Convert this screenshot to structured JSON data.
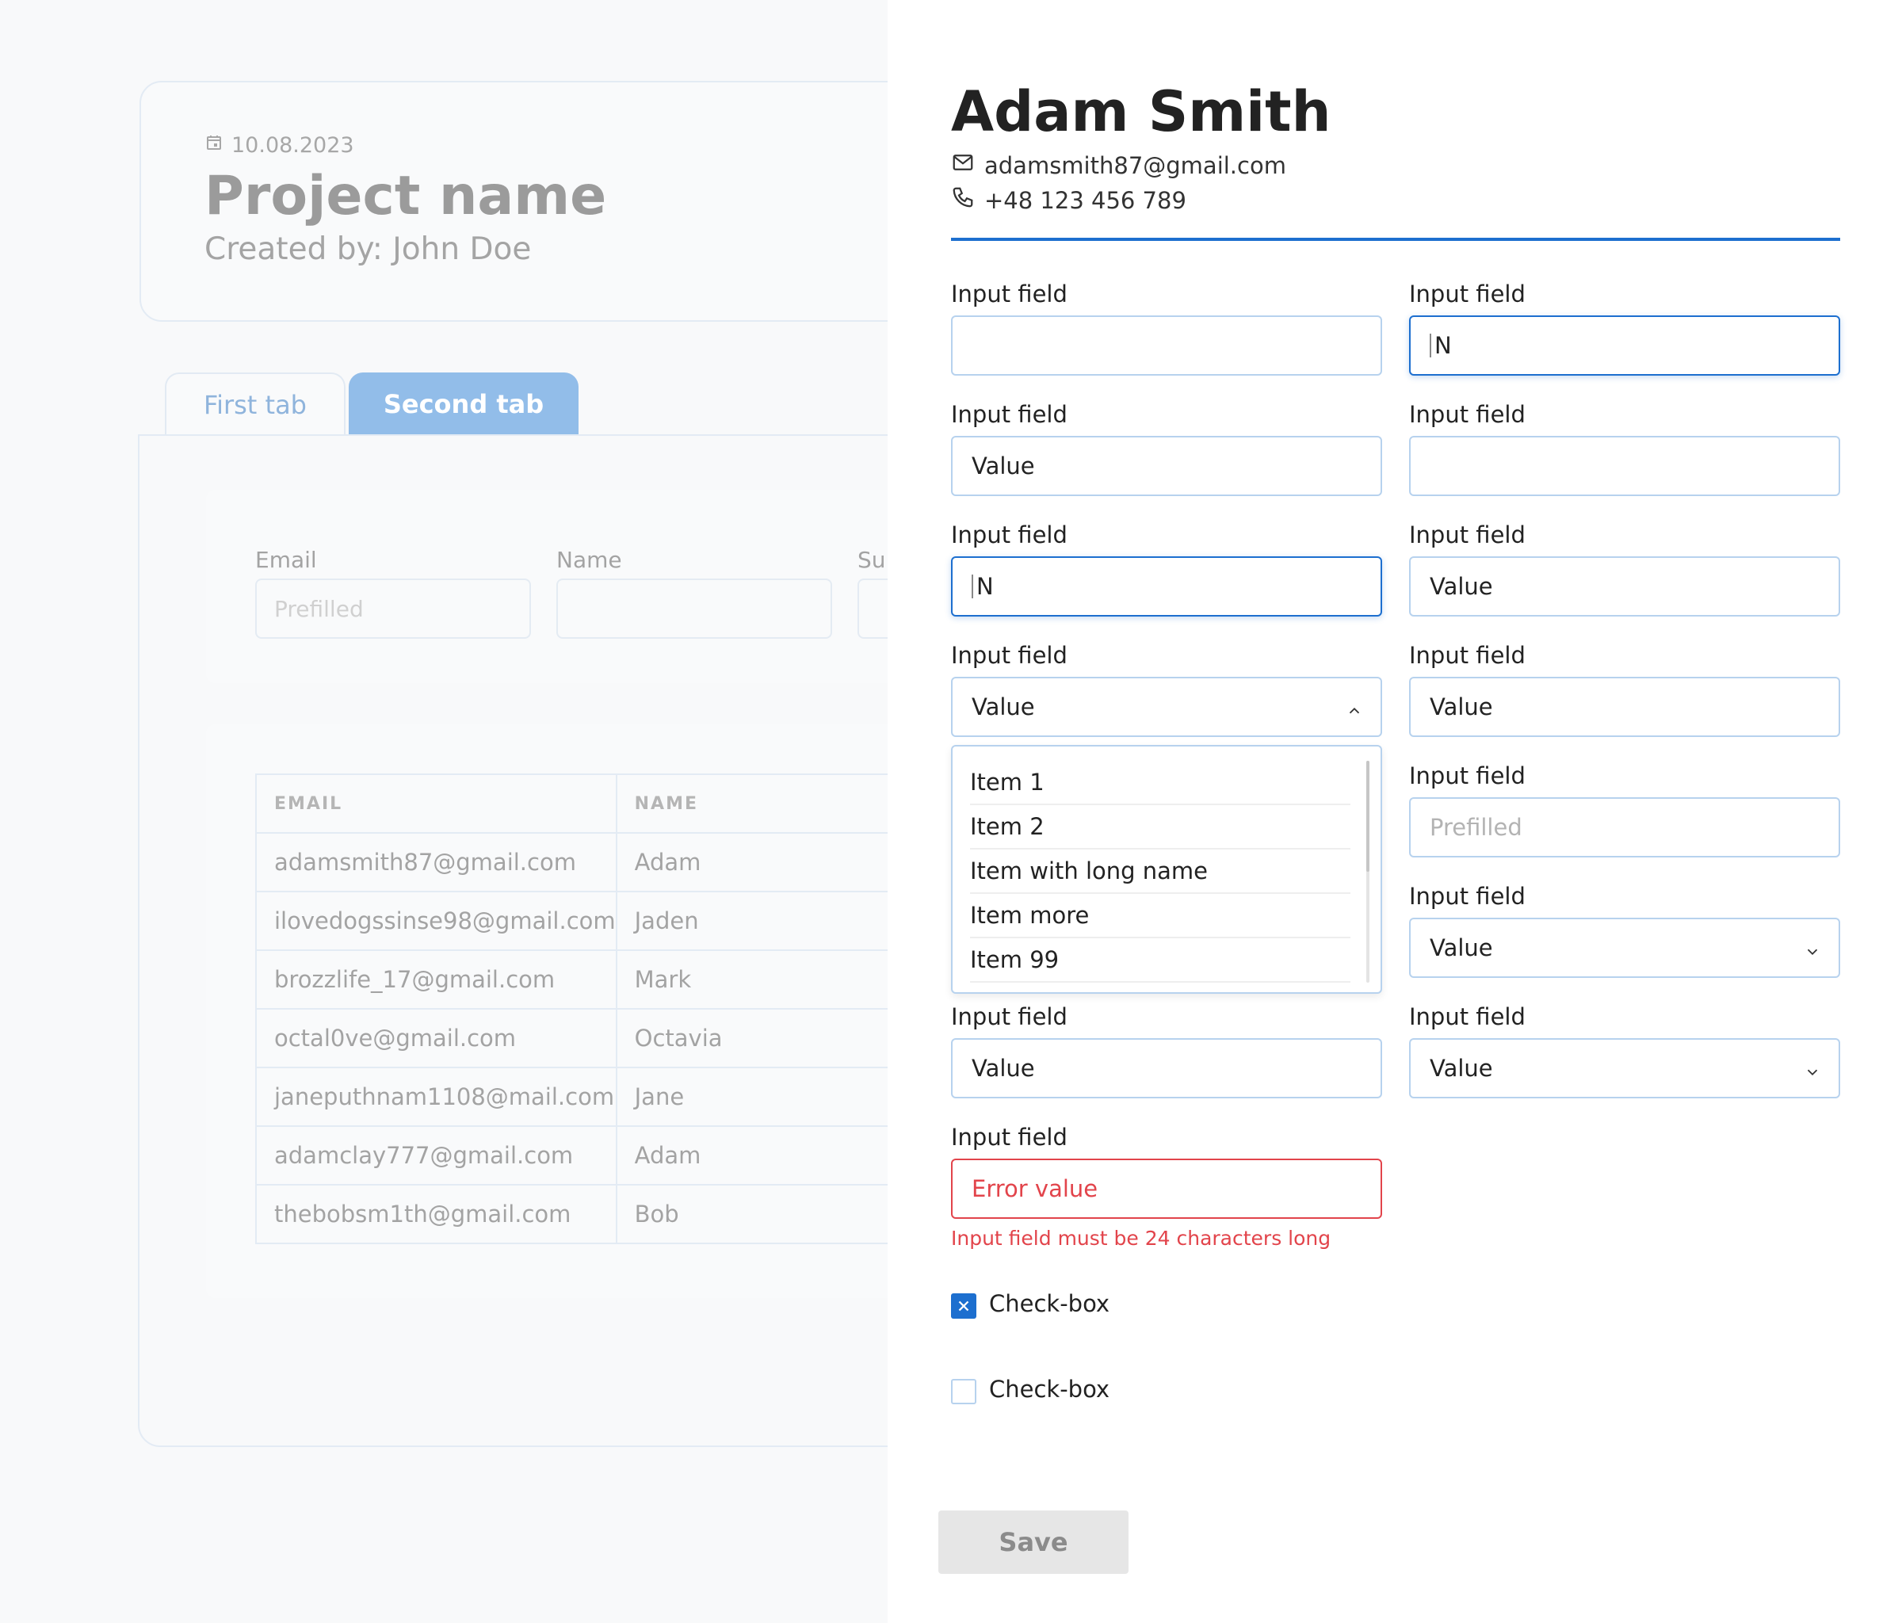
{
  "background": {
    "project": {
      "date": "10.08.2023",
      "title": "Project name",
      "created_by": "Created by: John Doe"
    },
    "tabs": [
      {
        "label": "First tab"
      },
      {
        "label": "Second tab"
      }
    ],
    "filters": {
      "email_label": "Email",
      "email_value": "Prefilled",
      "name_label": "Name",
      "third_label": "Sur"
    },
    "table": {
      "headers": [
        "EMAIL",
        "NAME"
      ],
      "rows": [
        [
          "adamsmith87@gmail.com",
          "Adam"
        ],
        [
          "ilovedogssinse98@gmail.com",
          "Jaden"
        ],
        [
          "brozzlife_17@gmail.com",
          "Mark"
        ],
        [
          "octal0ve@gmail.com",
          "Octavia"
        ],
        [
          "janeputhnam1108@mail.com",
          "Jane"
        ],
        [
          "adamclay777@gmail.com",
          "Adam"
        ],
        [
          "thebobsm1th@gmail.com",
          "Bob"
        ]
      ]
    }
  },
  "drawer": {
    "name": "Adam Smith",
    "email": "adamsmith87@gmail.com",
    "phone": "+48 123 456 789",
    "field_label": "Input field",
    "fields": {
      "r1_left": "",
      "r1_right": "N",
      "r2_left": "Value",
      "r2_right": "",
      "r3_left": "N",
      "r3_right": "Value",
      "r4_left": "Value",
      "r4_right": "Value",
      "r5_right": "Prefilled",
      "r6_right": "Value",
      "r7_left": "Value",
      "r7_right": "Value",
      "r8_left": "Error value"
    },
    "dropdown_items": [
      "Item 1",
      "Item 2",
      "Item with long name",
      "Item more",
      "Item 99"
    ],
    "error_message": "Input field must be 24 characters long",
    "checkbox_label": "Check-box",
    "checkbox_1_checked": true,
    "checkbox_2_checked": false,
    "save_label": "Save"
  },
  "colors": {
    "accent": "#1d6fcf",
    "error": "#e2444b",
    "field_border": "#b7d2ee",
    "tab_active": "#92bde9"
  },
  "icons": [
    "calendar-icon",
    "mail-icon",
    "phone-icon",
    "chevron-up-icon",
    "chevron-down-icon",
    "check-x-icon"
  ]
}
